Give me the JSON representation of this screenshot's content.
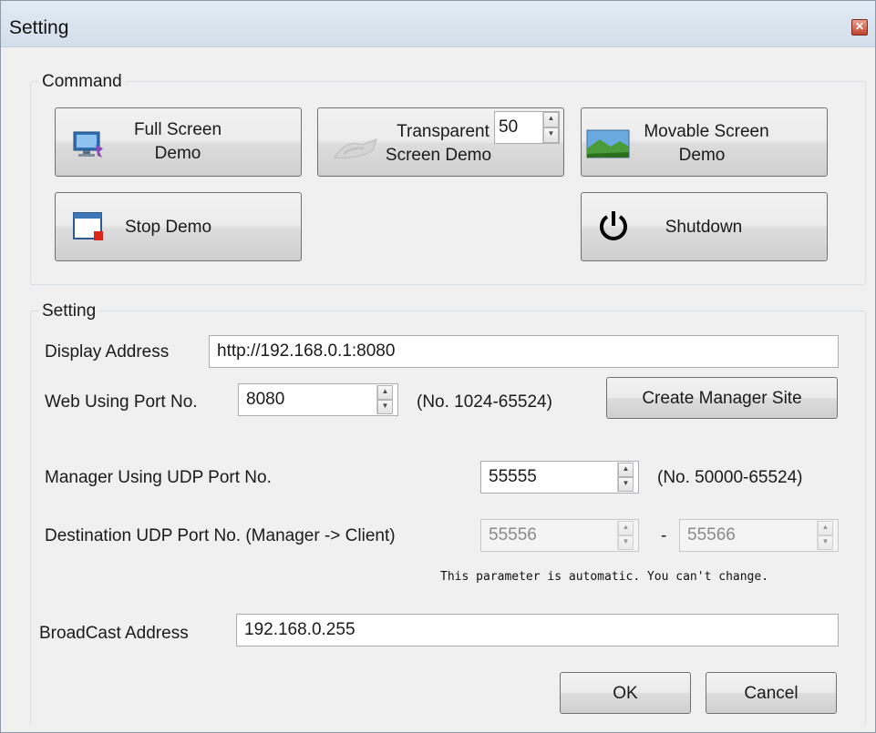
{
  "window": {
    "title": "Setting",
    "close_glyph": "✕"
  },
  "command": {
    "group_label": "Command",
    "full_screen": {
      "line1": "Full Screen",
      "line2": "Demo",
      "icon": "monitor-icon"
    },
    "transparent": {
      "line1": "Transparent",
      "line2": "Screen Demo",
      "icon": "transparent-icon",
      "opacity_value": "50"
    },
    "movable": {
      "line1": "Movable Screen",
      "line2": "Demo",
      "icon": "landscape-icon"
    },
    "stop": {
      "label": "Stop Demo",
      "icon": "window-stop-icon"
    },
    "shutdown": {
      "label": "Shutdown",
      "icon": "power-icon"
    }
  },
  "setting": {
    "group_label": "Setting",
    "display_address_label": "Display Address",
    "display_address_value": "http://192.168.0.1:8080",
    "web_port_label": "Web Using Port No.",
    "web_port_value": "8080",
    "web_port_range": "(No. 1024-65524)",
    "create_manager_site": "Create Manager Site",
    "manager_udp_label": "Manager Using UDP Port No.",
    "manager_udp_value": "55555",
    "manager_udp_range": "(No. 50000-65524)",
    "dest_udp_label": "Destination UDP Port No. (Manager -> Client)",
    "dest_udp_from": "55556",
    "dest_udp_separator": "-",
    "dest_udp_to": "55566",
    "auto_note": "This parameter is automatic. You can't change.",
    "broadcast_label": "BroadCast Address",
    "broadcast_value": "192.168.0.255"
  },
  "footer": {
    "ok": "OK",
    "cancel": "Cancel"
  },
  "colors": {
    "title_bar": "#d9e4ef",
    "close_red": "#c0442d",
    "face": "#f0f0f0"
  }
}
